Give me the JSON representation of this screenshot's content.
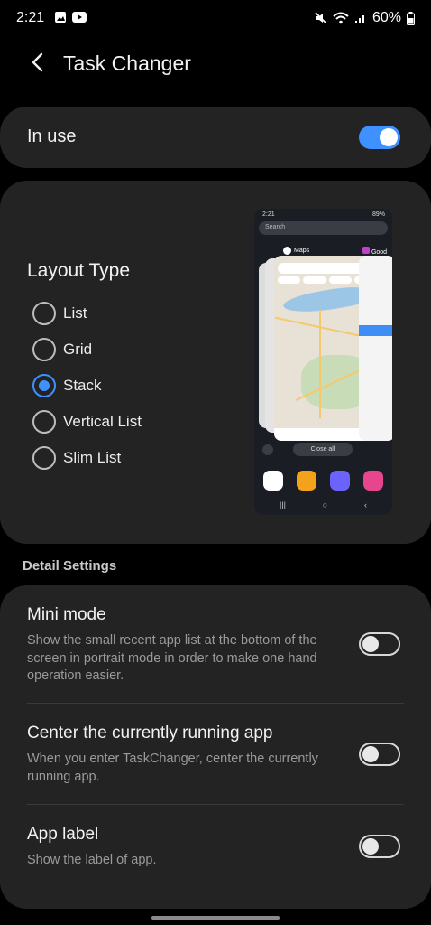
{
  "status_bar": {
    "time": "2:21",
    "battery": "60%"
  },
  "header": {
    "title": "Task Changer"
  },
  "in_use": {
    "label": "In use",
    "enabled": true
  },
  "layout": {
    "title": "Layout Type",
    "options": [
      {
        "label": "List",
        "selected": false
      },
      {
        "label": "Grid",
        "selected": false
      },
      {
        "label": "Stack",
        "selected": true
      },
      {
        "label": "Vertical List",
        "selected": false
      },
      {
        "label": "Slim List",
        "selected": false
      }
    ],
    "preview": {
      "time": "2:21",
      "battery": "89%",
      "search": "Search",
      "maps_label": "Maps",
      "other_label": "Good Lo",
      "close_all": "Close all"
    }
  },
  "detail": {
    "section_label": "Detail Settings",
    "items": [
      {
        "title": "Mini mode",
        "desc": "Show the small recent app list at the bottom of the screen in portrait mode in order to make one hand operation easier.",
        "enabled": false
      },
      {
        "title": "Center the currently running app",
        "desc": "When you enter TaskChanger, center the currently running app.",
        "enabled": false
      },
      {
        "title": "App label",
        "desc": "Show the label of app.",
        "enabled": false
      }
    ]
  },
  "colors": {
    "accent": "#3e91ff",
    "background": "#000000",
    "card": "#232323"
  }
}
